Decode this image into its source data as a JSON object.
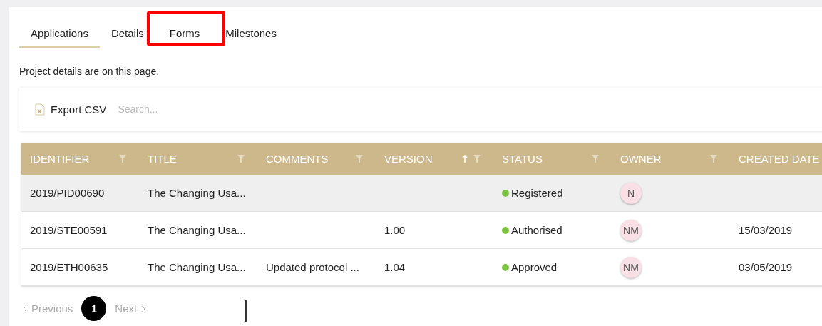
{
  "tabs": [
    {
      "label": "Applications",
      "selected": true,
      "highlighted": false
    },
    {
      "label": "Details",
      "selected": false,
      "highlighted": false
    },
    {
      "label": "Forms",
      "selected": false,
      "highlighted": true
    },
    {
      "label": "Milestones",
      "selected": false,
      "highlighted": false
    }
  ],
  "description": "Project details are on this page.",
  "toolbar": {
    "export_label": "Export CSV",
    "search": {
      "placeholder": "Search..."
    }
  },
  "table": {
    "columns": [
      {
        "label": "IDENTIFIER",
        "sorted": false
      },
      {
        "label": "TITLE",
        "sorted": false
      },
      {
        "label": "COMMENTS",
        "sorted": false
      },
      {
        "label": "VERSION",
        "sorted": true
      },
      {
        "label": "STATUS",
        "sorted": false
      },
      {
        "label": "OWNER",
        "sorted": false
      },
      {
        "label": "CREATED DATE",
        "sorted": false
      }
    ],
    "rows": [
      {
        "identifier": "2019/PID00690",
        "title": "The Changing Usa...",
        "status": "Registered",
        "color": "#7cc242",
        "owner": "N",
        "selected": true
      },
      {
        "identifier": "2019/STE00591",
        "title": "The Changing Usa...",
        "version": "1.00",
        "status": "Authorised",
        "color": "#7cc242",
        "owner": "NM",
        "created_date": "15/03/2019",
        "selected": false
      },
      {
        "identifier": "2019/ETH00635",
        "title": "The Changing Usa...",
        "comments": "Updated protocol ...",
        "version": "1.04",
        "status": "Approved",
        "color": "#7cc242",
        "owner": "NM",
        "created_date": "03/05/2019",
        "selected": false
      }
    ]
  },
  "pagination": {
    "previous": "Previous",
    "pages": [
      {
        "label": "1",
        "selected": true
      }
    ],
    "next": "Next"
  }
}
